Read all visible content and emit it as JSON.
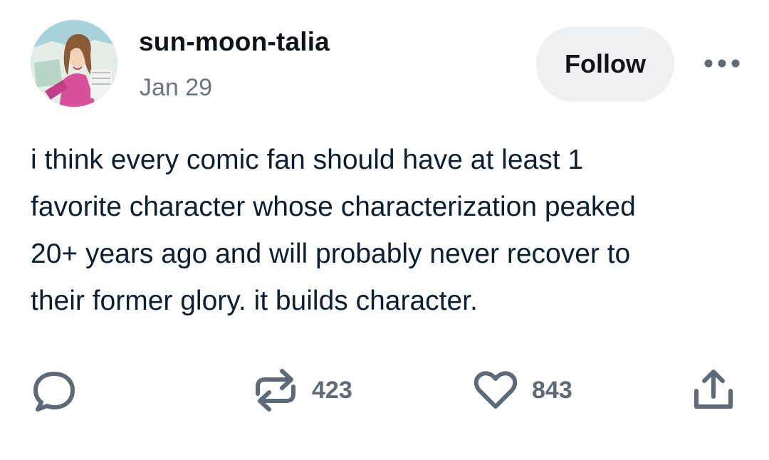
{
  "author": {
    "username": "sun-moon-talia",
    "date": "Jan 29"
  },
  "header": {
    "follow_label": "Follow"
  },
  "post": {
    "lines": [
      "i think every comic fan should have at least 1",
      "favorite character whose characterization peaked",
      "20+ years ago and will probably never recover to",
      "their former glory. it builds character."
    ]
  },
  "actions": {
    "reply_icon": "speech-bubble-icon",
    "repost_icon": "repost-arrows-icon",
    "repost_count": "423",
    "like_icon": "heart-icon",
    "like_count": "843",
    "share_icon": "share-upload-icon"
  },
  "colors": {
    "text": "#0b1f33",
    "muted": "#6b7480",
    "icon": "#5d6b78",
    "follow_bg": "#eef0f1"
  }
}
